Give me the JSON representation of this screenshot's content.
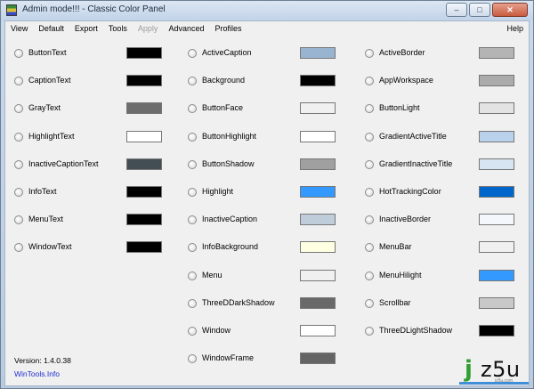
{
  "window": {
    "title": "Admin mode!!! - Classic Color Panel",
    "minimize": "–",
    "maximize": "□",
    "close": "✕"
  },
  "menu": {
    "items": [
      {
        "label": "View",
        "disabled": false
      },
      {
        "label": "Default",
        "disabled": false
      },
      {
        "label": "Export",
        "disabled": false
      },
      {
        "label": "Tools",
        "disabled": false
      },
      {
        "label": "Apply",
        "disabled": true
      },
      {
        "label": "Advanced",
        "disabled": false
      },
      {
        "label": "Profiles",
        "disabled": false
      }
    ],
    "help": "Help"
  },
  "columns": [
    [
      {
        "label": "ButtonText",
        "color": "#000000"
      },
      {
        "label": "CaptionText",
        "color": "#000000"
      },
      {
        "label": "GrayText",
        "color": "#6d6d6d"
      },
      {
        "label": "HighlightText",
        "color": "#ffffff"
      },
      {
        "label": "InactiveCaptionText",
        "color": "#434e54"
      },
      {
        "label": "InfoText",
        "color": "#000000"
      },
      {
        "label": "MenuText",
        "color": "#000000"
      },
      {
        "label": "WindowText",
        "color": "#000000"
      }
    ],
    [
      {
        "label": "ActiveCaption",
        "color": "#99b4d1"
      },
      {
        "label": "Background",
        "color": "#000000"
      },
      {
        "label": "ButtonFace",
        "color": "#f0f0f0"
      },
      {
        "label": "ButtonHighlight",
        "color": "#ffffff"
      },
      {
        "label": "ButtonShadow",
        "color": "#a0a0a0"
      },
      {
        "label": "Highlight",
        "color": "#3399ff"
      },
      {
        "label": "InactiveCaption",
        "color": "#bfcddb"
      },
      {
        "label": "InfoBackground",
        "color": "#ffffe1"
      },
      {
        "label": "Menu",
        "color": "#f0f0f0"
      },
      {
        "label": "ThreeDDarkShadow",
        "color": "#696969"
      },
      {
        "label": "Window",
        "color": "#ffffff"
      },
      {
        "label": "WindowFrame",
        "color": "#646464"
      }
    ],
    [
      {
        "label": "ActiveBorder",
        "color": "#b4b4b4"
      },
      {
        "label": "AppWorkspace",
        "color": "#ababab"
      },
      {
        "label": "ButtonLight",
        "color": "#e3e3e3"
      },
      {
        "label": "GradientActiveTitle",
        "color": "#b9d1ea"
      },
      {
        "label": "GradientInactiveTitle",
        "color": "#d7e4f2"
      },
      {
        "label": "HotTrackingColor",
        "color": "#0066cc"
      },
      {
        "label": "InactiveBorder",
        "color": "#f4f7fc"
      },
      {
        "label": "MenuBar",
        "color": "#f0f0f0"
      },
      {
        "label": "MenuHilight",
        "color": "#3399ff"
      },
      {
        "label": "Scrollbar",
        "color": "#c8c8c8"
      },
      {
        "label": "ThreeDLightShadow",
        "color": "#000000"
      }
    ]
  ],
  "footer": {
    "version": "Version: 1.4.0.38",
    "link": "WinTools.Info"
  },
  "watermark": {
    "j": "j",
    "text": "z5u",
    "sub": "jz5u.com"
  }
}
